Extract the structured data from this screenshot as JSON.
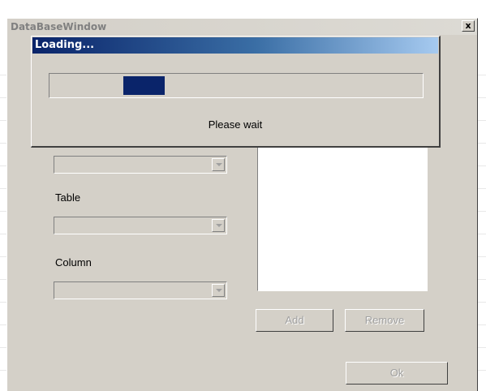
{
  "window": {
    "title": "DataBaseWindow",
    "close_glyph": "x"
  },
  "form": {
    "table_label": "Table",
    "column_label": "Column"
  },
  "buttons": {
    "add": "Add",
    "remove": "Remove",
    "ok": "Ok"
  },
  "loading": {
    "title": "Loading...",
    "message": "Please wait",
    "progress_indeterminate": true
  }
}
